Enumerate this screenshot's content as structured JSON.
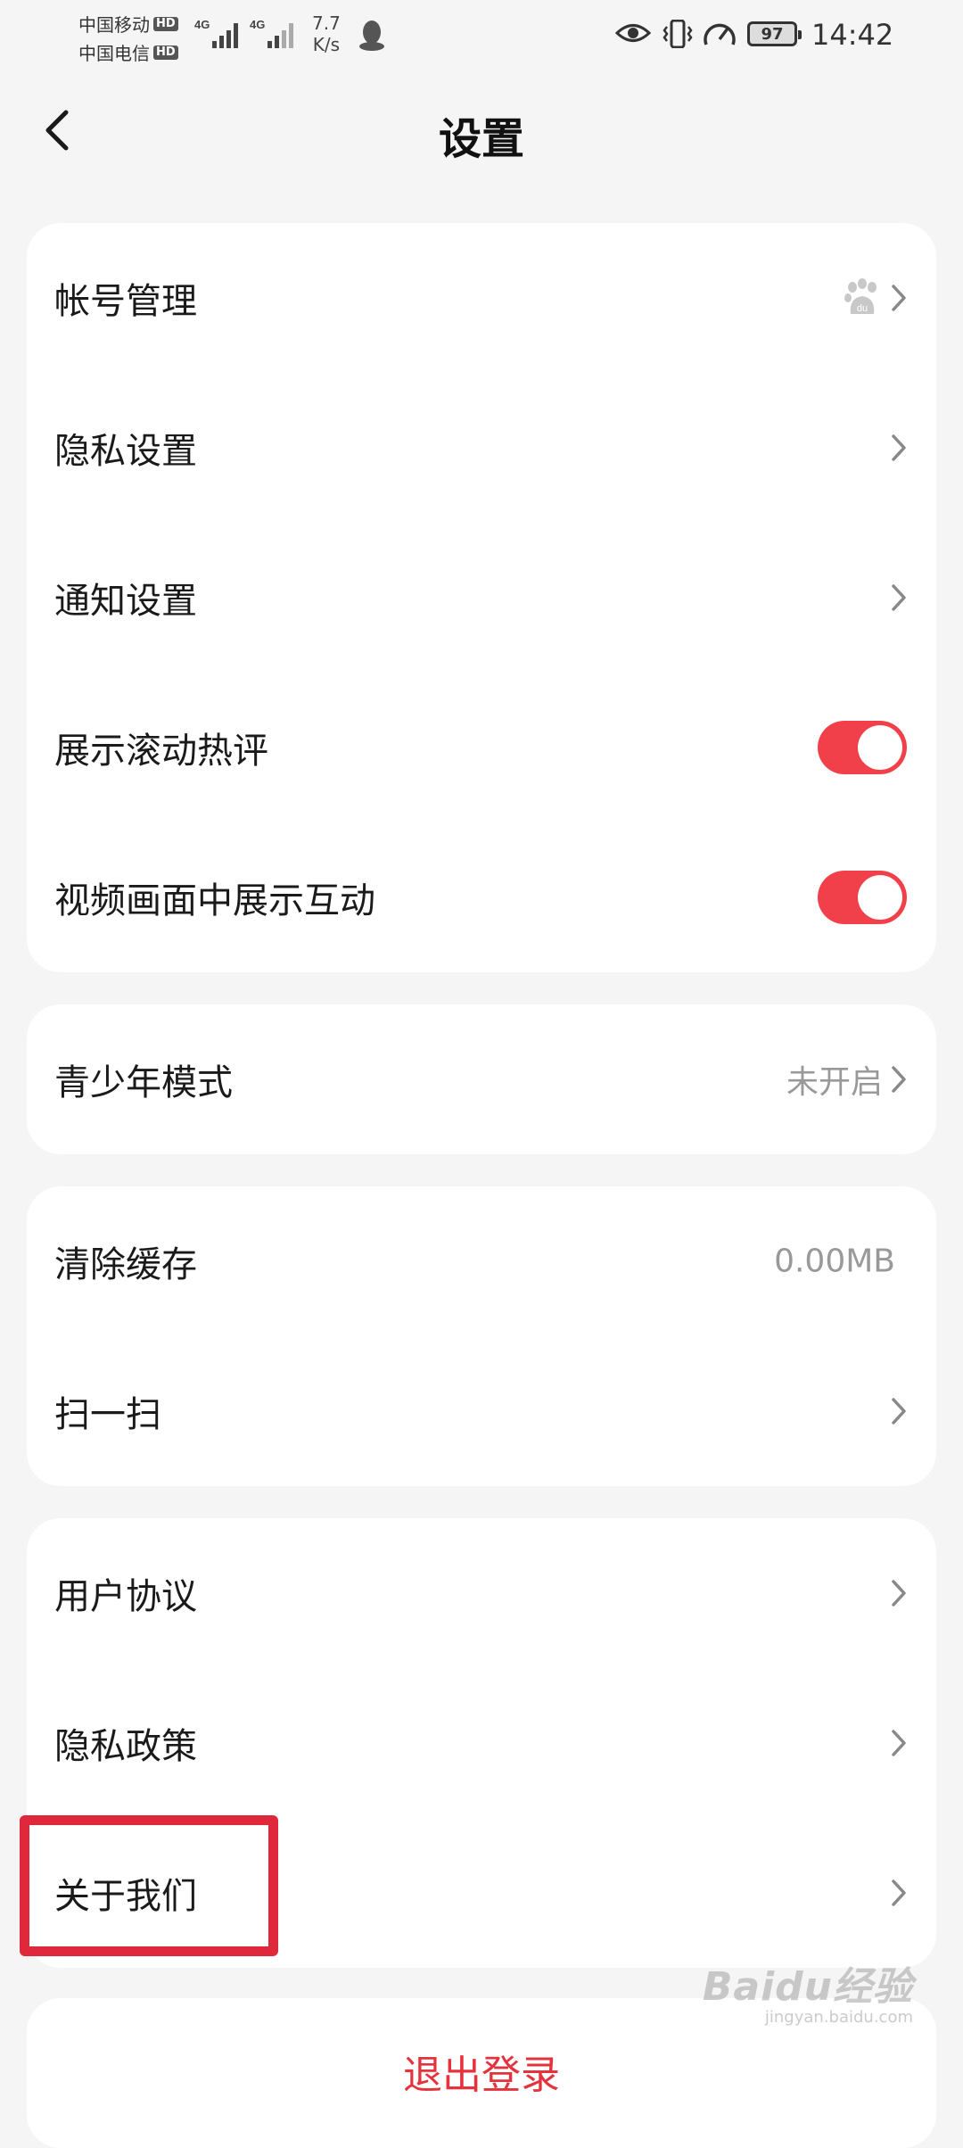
{
  "status_bar": {
    "carrier_1": "中国移动",
    "carrier_2": "中国电信",
    "hd_badge": "HD",
    "network_label": "4G",
    "speed_value": "7.7",
    "speed_unit": "K/s",
    "battery_level": "97",
    "time": "14:42"
  },
  "header": {
    "title": "设置",
    "back_icon": "chevron-left-icon"
  },
  "group_1": {
    "account": {
      "label": "帐号管理",
      "icon": "baidu-paw-icon"
    },
    "privacy_settings": {
      "label": "隐私设置"
    },
    "notification_settings": {
      "label": "通知设置"
    },
    "scrolling_comments": {
      "label": "展示滚动热评",
      "toggle_on": true
    },
    "video_interaction": {
      "label": "视频画面中展示互动",
      "toggle_on": true
    }
  },
  "group_2": {
    "youth_mode": {
      "label": "青少年模式",
      "value": "未开启"
    }
  },
  "group_3": {
    "clear_cache": {
      "label": "清除缓存",
      "value": "0.00MB"
    },
    "scan": {
      "label": "扫一扫"
    }
  },
  "group_4": {
    "user_agreement": {
      "label": "用户协议"
    },
    "privacy_policy": {
      "label": "隐私政策"
    },
    "about_us": {
      "label": "关于我们"
    }
  },
  "logout": {
    "label": "退出登录"
  },
  "watermark": {
    "brand": "Baidu经验",
    "url": "jingyan.baidu.com"
  },
  "colors": {
    "accent": "#f2404a",
    "logout_text": "#e5333d",
    "highlight": "#e0283c",
    "background": "#f5f5f5",
    "card": "#ffffff"
  }
}
